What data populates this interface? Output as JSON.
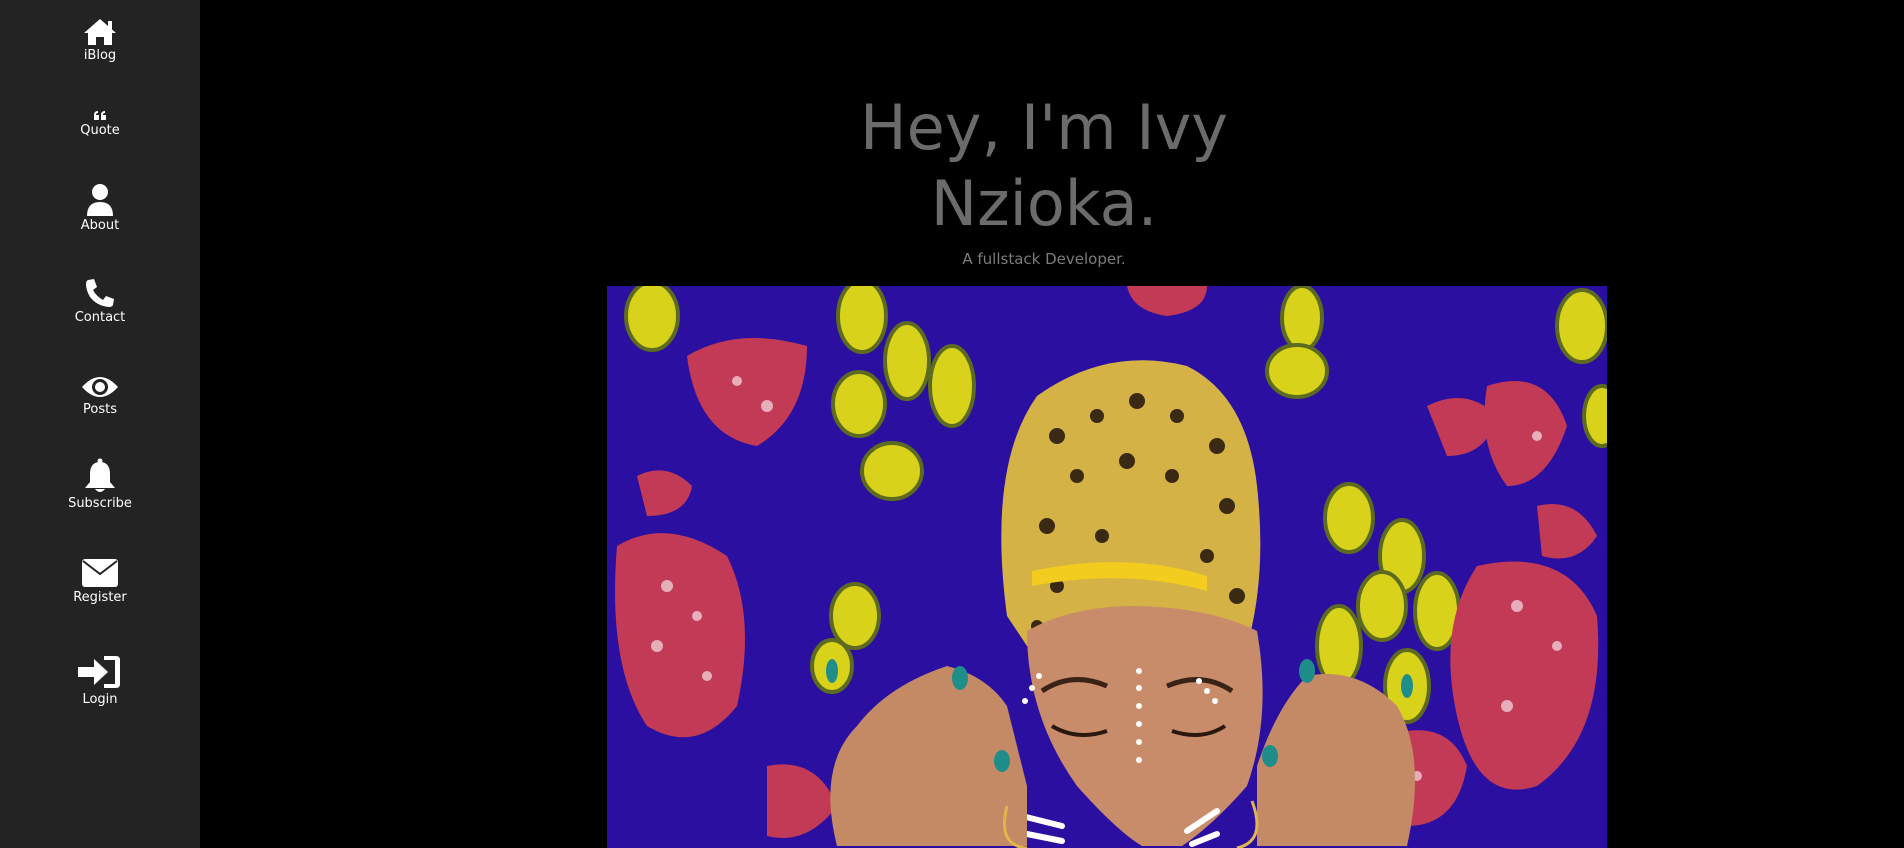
{
  "sidebar": {
    "items": [
      {
        "label": "iBlog",
        "icon": "home-icon"
      },
      {
        "label": "Quote",
        "icon": "quote-icon"
      },
      {
        "label": "About",
        "icon": "user-icon"
      },
      {
        "label": "Contact",
        "icon": "phone-icon"
      },
      {
        "label": "Posts",
        "icon": "eye-icon"
      },
      {
        "label": "Subscribe",
        "icon": "bell-icon"
      },
      {
        "label": "Register",
        "icon": "envelope-icon"
      },
      {
        "label": "Login",
        "icon": "sign-in-icon"
      }
    ]
  },
  "hero": {
    "title_line1": "Hey, I'm Ivy",
    "title_line2": "Nzioka.",
    "subtitle": "A fullstack Developer."
  },
  "colors": {
    "sidebar_bg": "#232323",
    "page_bg": "#000000",
    "title": "#6b6b6b",
    "image_bg": "#2a0fa0"
  }
}
